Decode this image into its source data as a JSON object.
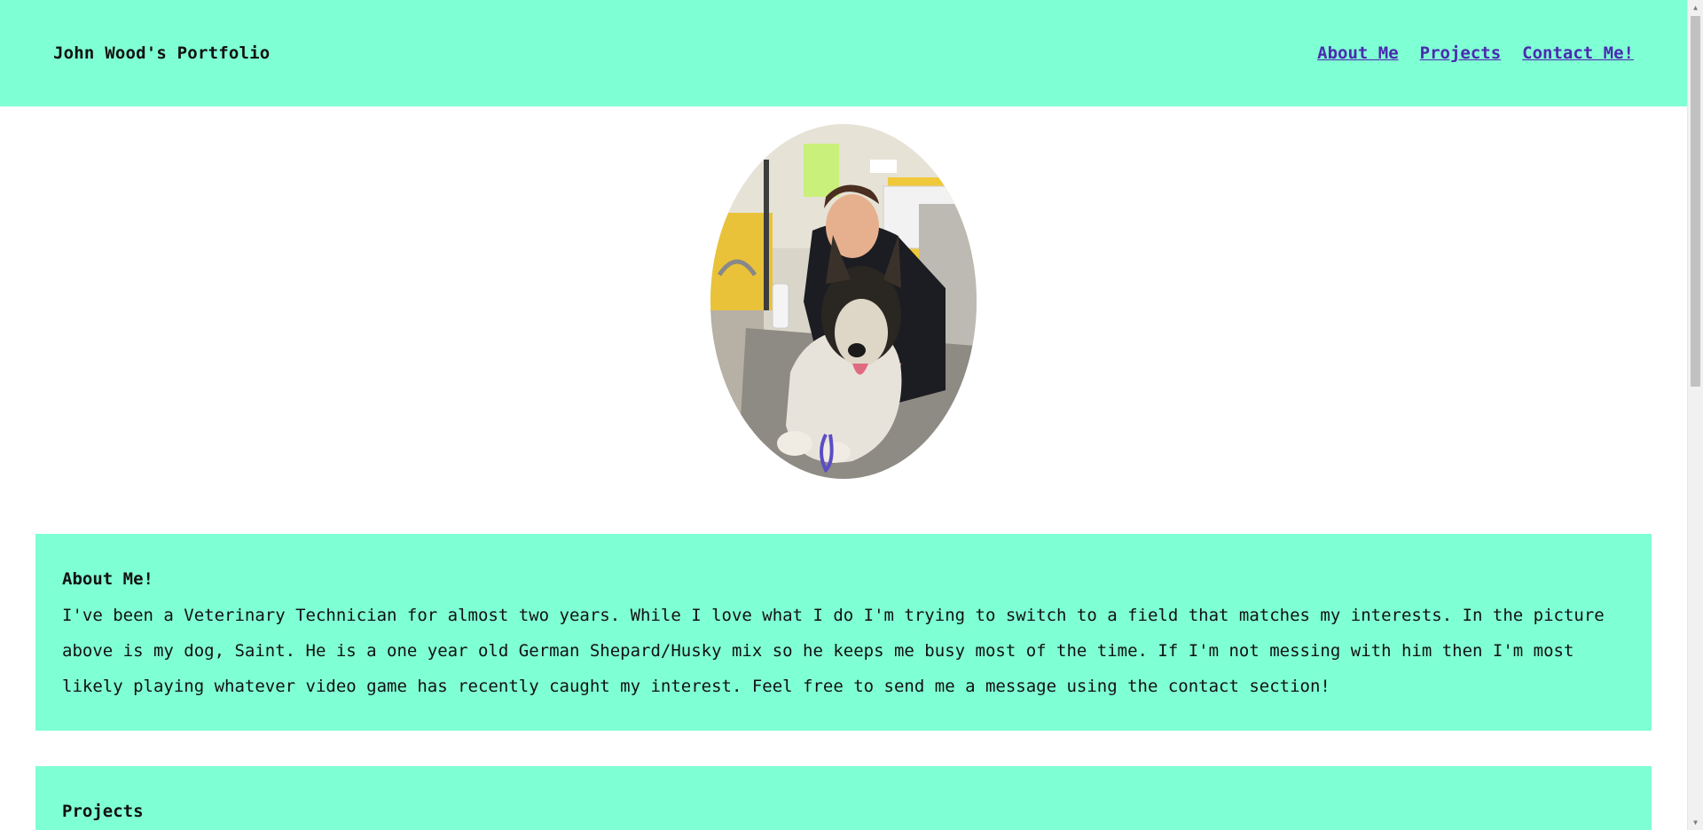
{
  "header": {
    "title": "John Wood's Portfolio",
    "nav": [
      {
        "label": "About Me"
      },
      {
        "label": "Projects"
      },
      {
        "label": "Contact Me!"
      }
    ]
  },
  "hero": {
    "photo_alt": "John with his dog Saint"
  },
  "about": {
    "heading": "About Me!",
    "body": "I've been a Veterinary Technician for almost two years. While I love what I do I'm trying to switch to a field that matches my interests. In the picture above is my dog, Saint. He is a one year old German Shepard/Husky mix so he keeps me busy most of the time. If I'm not messing with him then I'm most likely playing whatever video game has recently caught my interest. Feel free to send me a message using the contact section!"
  },
  "projects": {
    "heading": "Projects"
  },
  "colors": {
    "accent": "#7fffd4",
    "link": "#4b2ab0"
  }
}
